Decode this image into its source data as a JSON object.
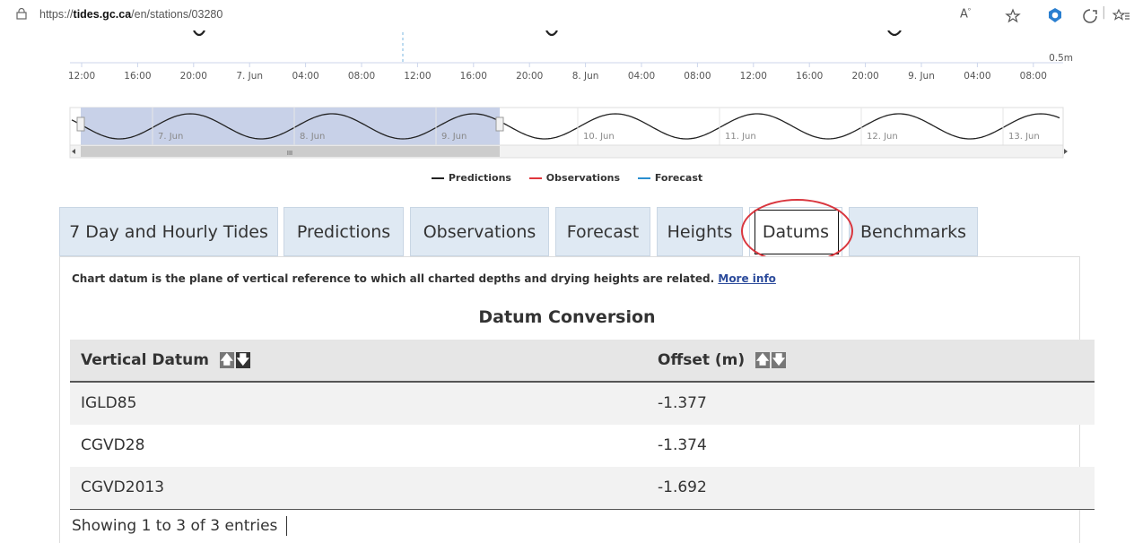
{
  "browser": {
    "url_prefix": "https://",
    "url_domain": "tides.gc.ca",
    "url_path": "/en/stations/03280"
  },
  "chart": {
    "y_label": "0.5m",
    "x_ticks": [
      "12:00",
      "16:00",
      "20:00",
      "7. Jun",
      "04:00",
      "08:00",
      "12:00",
      "16:00",
      "20:00",
      "8. Jun",
      "04:00",
      "08:00",
      "12:00",
      "16:00",
      "20:00",
      "9. Jun",
      "04:00",
      "08:00"
    ],
    "navigator_labels": [
      "7. Jun",
      "8. Jun",
      "9. Jun",
      "10. Jun",
      "11. Jun",
      "12. Jun",
      "13. Jun"
    ],
    "scroll_grip": "III"
  },
  "legend": [
    {
      "label": "Predictions",
      "color": "#222222"
    },
    {
      "label": "Observations",
      "color": "#e0363c"
    },
    {
      "label": "Forecast",
      "color": "#2a8fd0"
    }
  ],
  "tabs": [
    {
      "label": "7 Day and Hourly Tides"
    },
    {
      "label": "Predictions"
    },
    {
      "label": "Observations"
    },
    {
      "label": "Forecast"
    },
    {
      "label": "Heights"
    },
    {
      "label": "Datums"
    },
    {
      "label": "Benchmarks"
    }
  ],
  "datums": {
    "description": "Chart datum is the plane of vertical reference to which all charted depths and drying heights are related.",
    "more_info": "More info",
    "title": "Datum Conversion",
    "columns": [
      "Vertical Datum",
      "Offset (m)"
    ],
    "rows": [
      {
        "datum": "IGLD85",
        "offset": "-1.377"
      },
      {
        "datum": "CGVD28",
        "offset": "-1.374"
      },
      {
        "datum": "CGVD2013",
        "offset": "-1.692"
      }
    ],
    "info": "Showing 1 to 3 of 3 entries"
  }
}
